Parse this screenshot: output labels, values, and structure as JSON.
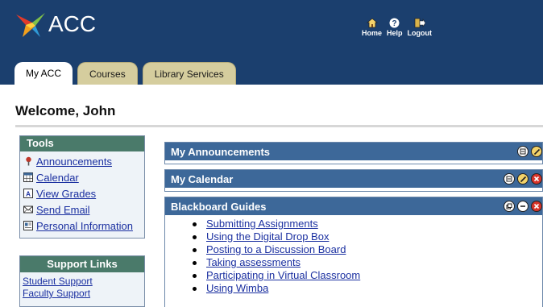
{
  "header": {
    "brand": "ACC",
    "links": [
      {
        "label": "Home",
        "icon": "home-icon"
      },
      {
        "label": "Help",
        "icon": "help-icon"
      },
      {
        "label": "Logout",
        "icon": "logout-icon"
      }
    ]
  },
  "tabs": [
    {
      "label": "My ACC",
      "active": true
    },
    {
      "label": "Courses",
      "active": false
    },
    {
      "label": "Library Services",
      "active": false
    }
  ],
  "welcome": "Welcome, John",
  "tools": {
    "title": "Tools",
    "items": [
      {
        "label": "Announcements",
        "icon": "announcements-icon"
      },
      {
        "label": "Calendar",
        "icon": "calendar-icon"
      },
      {
        "label": "View Grades",
        "icon": "grades-icon"
      },
      {
        "label": "Send Email",
        "icon": "email-icon"
      },
      {
        "label": "Personal Information",
        "icon": "personal-info-icon"
      }
    ]
  },
  "support": {
    "title": "Support Links",
    "links": [
      "Student Support",
      "Faculty Support"
    ]
  },
  "modules": {
    "announcements": {
      "title": "My Announcements"
    },
    "calendar": {
      "title": "My Calendar"
    },
    "guides": {
      "title": "Blackboard Guides",
      "items": [
        "Submitting Assignments",
        "Using the Digital Drop Box",
        "Posting to a Discussion Board",
        "Taking assessments",
        "Participating in Virtual Classroom",
        "Using Wimba"
      ]
    }
  },
  "colors": {
    "header_bg": "#1b3f6e",
    "module_header": "#3d6899",
    "sidebox_title": "#4a7a6a",
    "tab_inactive": "#d5cd9e",
    "link": "#1a2fa0"
  }
}
